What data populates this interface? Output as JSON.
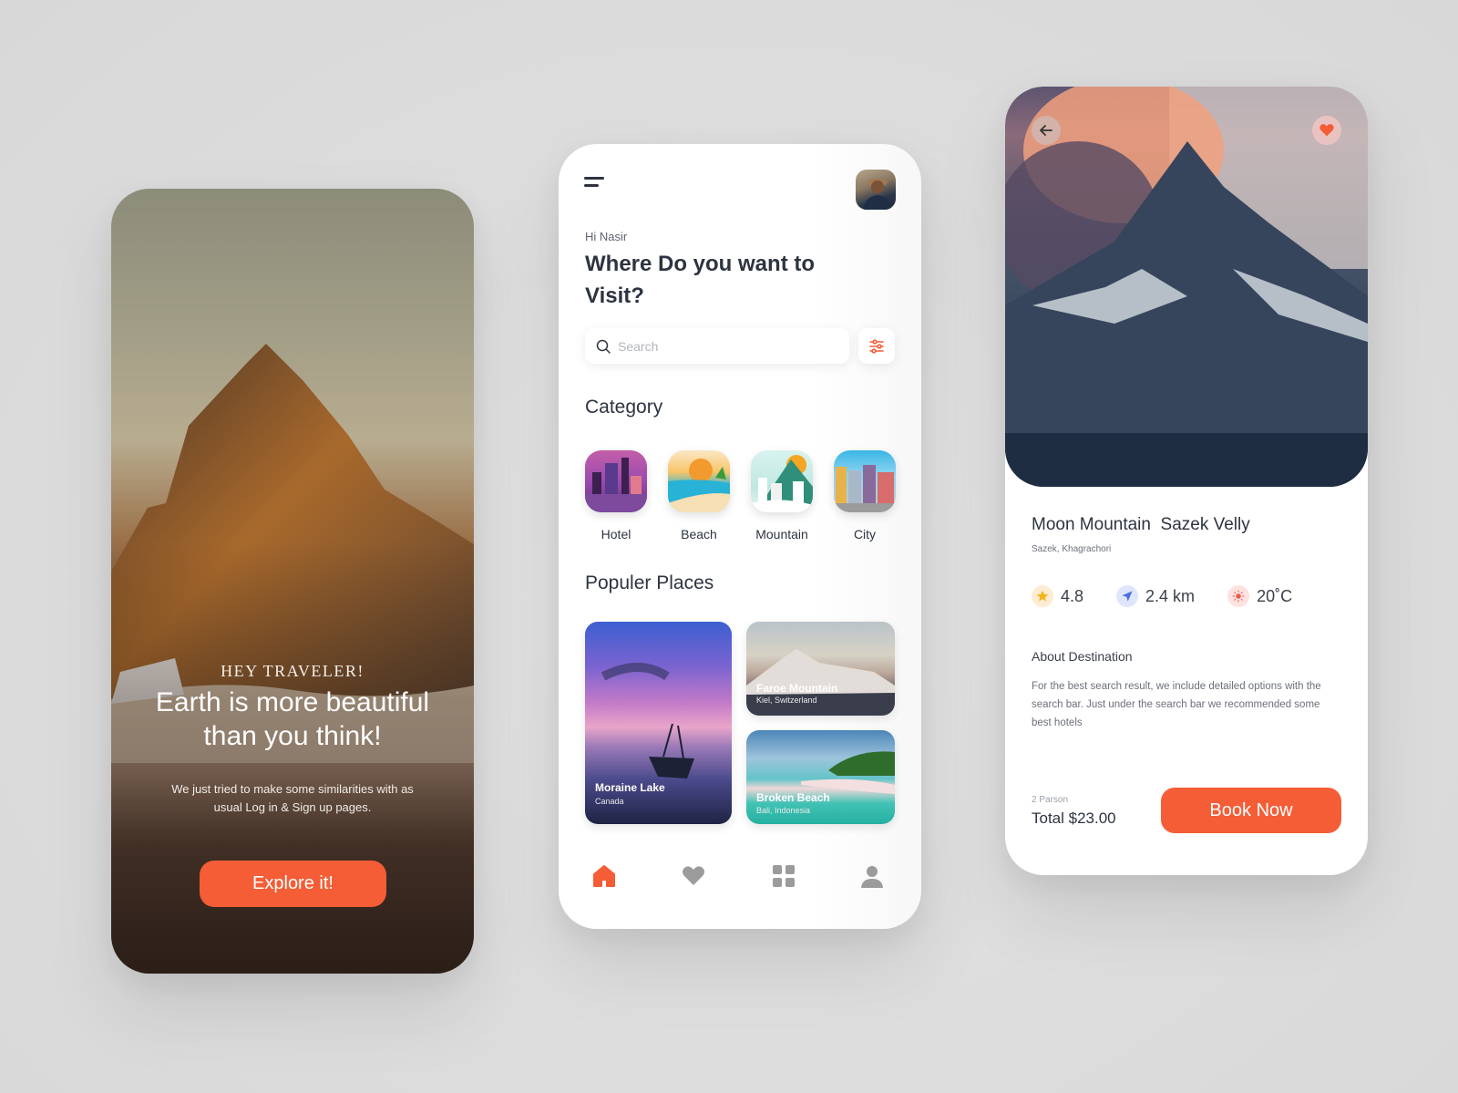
{
  "colors": {
    "accent": "#f45d36",
    "text_dark": "#2d3440",
    "text_muted": "#6b707a",
    "background": "#dedede"
  },
  "splash": {
    "kicker": "HEY TRAVELER!",
    "headline_line1": "Earth is more beautiful",
    "headline_line2": "than you think!",
    "subtitle": "We just tried to make some similarities with as usual Log in & Sign up pages.",
    "cta_label": "Explore it!"
  },
  "home": {
    "menu_icon": "menu-icon",
    "avatar_icon": "user-photo",
    "greeting": "Hi Nasir",
    "title": "Where Do you want to Visit?",
    "search": {
      "placeholder": "Search",
      "value": ""
    },
    "filter_icon": "sliders-icon",
    "category_title": "Category",
    "categories": [
      {
        "label": "Hotel"
      },
      {
        "label": "Beach"
      },
      {
        "label": "Mountain"
      },
      {
        "label": "City"
      }
    ],
    "popular_title": "Populer Places",
    "places": [
      {
        "name": "Moraine Lake",
        "location": "Canada"
      },
      {
        "name": "Faroe Mountain",
        "location": "Kiel, Switzerland"
      },
      {
        "name": "Broken Beach",
        "location": "Bali, Indonesia"
      }
    ],
    "nav": [
      {
        "icon": "home-icon",
        "active": true
      },
      {
        "icon": "heart-icon",
        "active": false
      },
      {
        "icon": "grid-icon",
        "active": false
      },
      {
        "icon": "profile-icon",
        "active": false
      }
    ]
  },
  "details": {
    "back_icon": "arrow-left-icon",
    "favorite_icon": "heart-icon",
    "name": "Moon Mountain  Sazek Velly",
    "location": "Sazek, Khagrachori",
    "stats": [
      {
        "icon": "star-icon",
        "value": "4.8"
      },
      {
        "icon": "navigation-icon",
        "value": "2.4 km"
      },
      {
        "icon": "sun-icon",
        "value": "20˚C"
      }
    ],
    "about_title": "About Destination",
    "about_text": "For the best search result, we include detailed options with the search bar. Just under the search bar we recommended some best hotels",
    "persons": "2 Parson",
    "total": "Total $23.00",
    "book_label": "Book Now"
  }
}
